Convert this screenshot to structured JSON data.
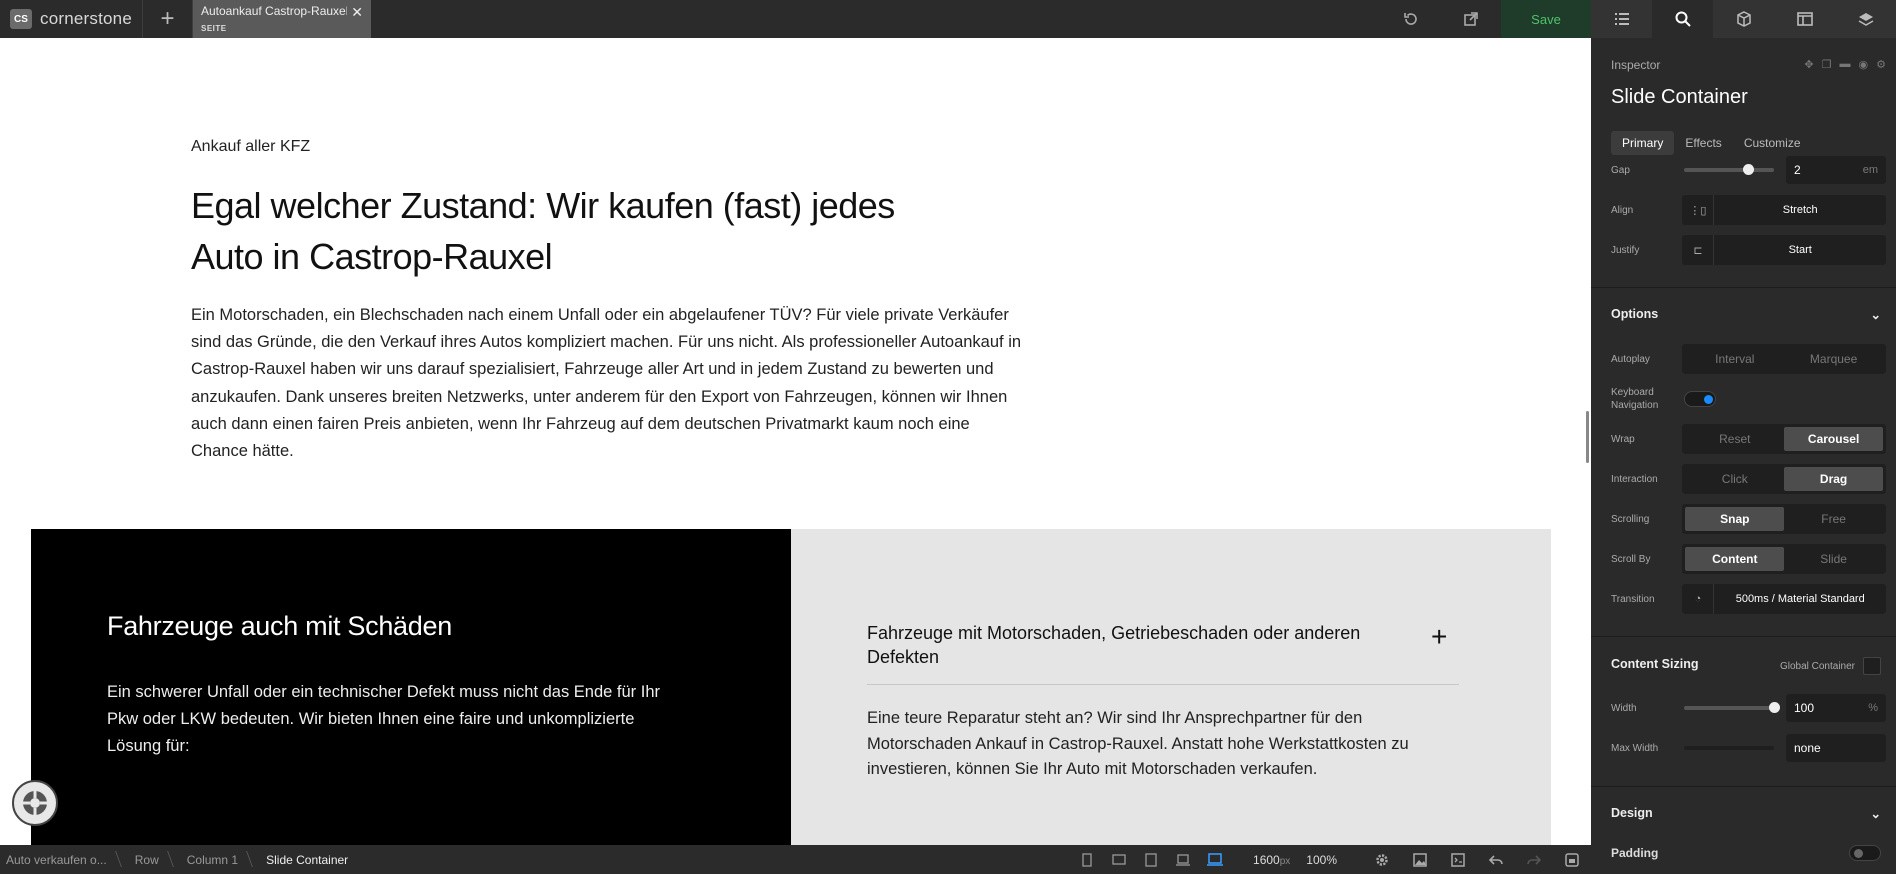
{
  "topbar": {
    "logo_badge": "CS",
    "logo_text": "cornerstone",
    "tab_title": "Autoankauf Castrop-Rauxel",
    "tab_subtitle": "SEITE",
    "save_label": "Save"
  },
  "canvas": {
    "kicker": "Ankauf aller KFZ",
    "headline": "Egal welcher Zustand: Wir kaufen (fast) jedes Auto in Castrop-Rauxel",
    "lead": "Ein Motorschaden, ein Blechschaden nach einem Unfall oder ein abgelaufener TÜV? Für viele private Verkäufer sind das Gründe, die den Verkauf ihres Autos kompliziert machen. Für uns nicht. Als professioneller Autoankauf in Castrop-Rauxel haben wir uns darauf spezialisiert, Fahrzeuge aller Art und in jedem Zustand zu bewerten und anzukaufen. Dank unseres breiten Netzwerks, unter anderem für den Export von Fahrzeugen, können wir Ihnen auch dann einen fairen Preis anbieten, wenn Ihr Fahrzeug auf dem deutschen Privatmarkt kaum noch eine Chance hätte.",
    "dark_heading": "Fahrzeuge auch mit Schäden",
    "dark_text": "Ein schwerer Unfall oder ein technischer Defekt muss nicht das Ende für Ihr Pkw oder LKW bedeuten. Wir bieten Ihnen eine faire und unkomplizierte Lösung für:",
    "accordion_title": "Fahrzeuge mit Motorschaden, Getriebeschaden oder anderen Defekten",
    "accordion_text": "Eine teure Reparatur steht an? Wir sind Ihr Ansprechpartner für den Motorschaden Ankauf in Castrop-Rauxel. Anstatt hohe Werkstattkosten zu investieren, können Sie Ihr Auto mit Motorschaden verkaufen."
  },
  "breadcrumbs": [
    "Auto verkaufen o...",
    "Row",
    "Column 1",
    "Slide Container"
  ],
  "bottombar": {
    "width_value": "1600",
    "width_unit": "px",
    "zoom": "100%"
  },
  "inspector": {
    "label": "Inspector",
    "title": "Slide Container",
    "tabs": [
      "Primary",
      "Effects",
      "Customize"
    ],
    "gap": {
      "label": "Gap",
      "value": "2",
      "unit": "em",
      "slider_level": 0.7
    },
    "align": {
      "label": "Align",
      "value": "Stretch"
    },
    "justify": {
      "label": "Justify",
      "value": "Start"
    },
    "options_title": "Options",
    "autoplay": {
      "label": "Autoplay",
      "options": [
        "Interval",
        "Marquee"
      ]
    },
    "keyboard": {
      "label": "Keyboard Navigation",
      "on": true
    },
    "wrap": {
      "label": "Wrap",
      "options": [
        "Reset",
        "Carousel"
      ],
      "selected": "Carousel"
    },
    "interaction": {
      "label": "Interaction",
      "options": [
        "Click",
        "Drag"
      ],
      "selected": "Drag"
    },
    "scrolling": {
      "label": "Scrolling",
      "options": [
        "Snap",
        "Free"
      ],
      "selected": "Snap"
    },
    "scroll_by": {
      "label": "Scroll By",
      "options": [
        "Content",
        "Slide"
      ],
      "selected": "Content"
    },
    "transition": {
      "label": "Transition",
      "value": "500ms / Material Standard"
    },
    "content_sizing_title": "Content Sizing",
    "global_container_label": "Global Container",
    "width": {
      "label": "Width",
      "value": "100",
      "unit": "%",
      "slider_level": 1.0
    },
    "max_width": {
      "label": "Max Width",
      "value": "none"
    },
    "design_title": "Design",
    "padding_label": "Padding"
  },
  "colors": {
    "accent": "#1a8cff",
    "save_green": "#4fc26a"
  }
}
